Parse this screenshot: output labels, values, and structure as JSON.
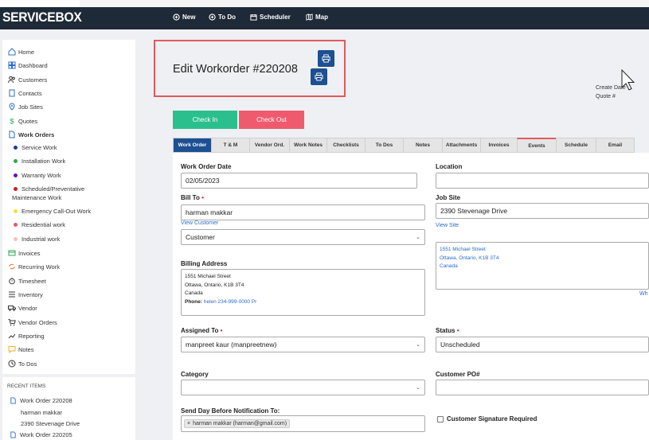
{
  "app": {
    "brand": "SERVICEBOX"
  },
  "navbar": {
    "items": [
      {
        "label": "New",
        "icon": "plus-circle-icon"
      },
      {
        "label": "To Do",
        "icon": "plus-circle-icon"
      },
      {
        "label": "Scheduler",
        "icon": "calendar-icon"
      },
      {
        "label": "Map",
        "icon": "map-icon"
      }
    ]
  },
  "sidebar": {
    "items": [
      {
        "label": "Home",
        "icon": "home-icon"
      },
      {
        "label": "Dashboard",
        "icon": "dashboard-icon"
      },
      {
        "label": "Customers",
        "icon": "users-icon"
      },
      {
        "label": "Contacts",
        "icon": "contacts-icon"
      },
      {
        "label": "Job Sites",
        "icon": "location-icon"
      },
      {
        "label": "Quotes",
        "icon": "dollar-icon"
      },
      {
        "label": "Work Orders",
        "icon": "document-icon"
      },
      {
        "label": "Invoices",
        "icon": "invoice-icon"
      },
      {
        "label": "Recurring Work",
        "icon": "recurring-icon"
      },
      {
        "label": "Timesheet",
        "icon": "stopwatch-icon"
      },
      {
        "label": "Inventory",
        "icon": "list-icon"
      },
      {
        "label": "Vendor",
        "icon": "truck-icon"
      },
      {
        "label": "Vendor Orders",
        "icon": "cart-icon"
      },
      {
        "label": "Reporting",
        "icon": "trend-icon"
      },
      {
        "label": "Notes",
        "icon": "note-icon"
      },
      {
        "label": "To Dos",
        "icon": "clock-icon"
      }
    ],
    "work_order_types": [
      {
        "label": "Service Work",
        "color": "#1d3f91"
      },
      {
        "label": "Installation Work",
        "color": "#2fa84f"
      },
      {
        "label": "Warranty Work",
        "color": "#5a1ca8"
      },
      {
        "label": "Scheduled/Preventative",
        "label2": "Maintenance Work",
        "color": "#d01c1c"
      },
      {
        "label": "Emergency Call-Out Work",
        "color": "#f0e04a"
      },
      {
        "label": "Residential work",
        "color": "#e35a6a"
      },
      {
        "label": "Industrial work",
        "color": "#f4c2c2"
      }
    ]
  },
  "recent": {
    "heading": "RECENT ITEMS",
    "items": [
      {
        "title": "Work Order 220208",
        "lines": [
          "harman makkar",
          "2390 Stevenage Drive"
        ]
      },
      {
        "title": "Work Order 220205",
        "lines": []
      }
    ]
  },
  "header": {
    "title": "Edit Workorder #220208",
    "side_note_1": "Create Date",
    "side_note_2": "Quote #"
  },
  "actions": {
    "check_in": "Check In",
    "check_out": "Check Out"
  },
  "tabs": [
    "Work Order",
    "T & M",
    "Vendor Ord.",
    "Work Notes",
    "Checklists",
    "To Dos",
    "Notes",
    "Attachments",
    "Invoices",
    "Events",
    "Schedule",
    "Email"
  ],
  "form": {
    "work_order_date": {
      "label": "Work Order Date",
      "value": "02/05/2023"
    },
    "location": {
      "label": "Location",
      "value": ""
    },
    "bill_to": {
      "label": "Bill To",
      "value": "harman makkar",
      "link": "View Customer",
      "type_value": "Customer"
    },
    "job_site": {
      "label": "Job Site",
      "value": "2390 Stevenage Drive",
      "link": "View Site",
      "address": [
        "1551 Michael Street",
        "Ottawa, Ontario, K1B 3T4",
        "Canada"
      ],
      "corner_link": "Wh"
    },
    "billing_address": {
      "label": "Billing Address",
      "lines": [
        "1551 Michael Street",
        "Ottawa, Ontario, K1B 3T4",
        "Canada"
      ],
      "phone_label": "Phone:",
      "phone_value": "helen 234-999-0000 Pr"
    },
    "assigned_to": {
      "label": "Assigned To",
      "value": "manpreet kaur (manpreetnew)"
    },
    "status": {
      "label": "Status",
      "value": "Unscheduled"
    },
    "category": {
      "label": "Category",
      "value": ""
    },
    "customer_po": {
      "label": "Customer PO#",
      "value": ""
    },
    "notification": {
      "label": "Send Day Before Notification To:",
      "tag": "harman makkar (harman@gmail.com)"
    },
    "signature": {
      "label": "Customer Signature Required"
    }
  },
  "colors": {
    "navbar": "#1e2a38",
    "primary": "#1d4f91",
    "check_in": "#2cbf8e",
    "check_out": "#f05a6e",
    "highlight_box": "#e05a5a",
    "link": "#2a6cc9"
  }
}
